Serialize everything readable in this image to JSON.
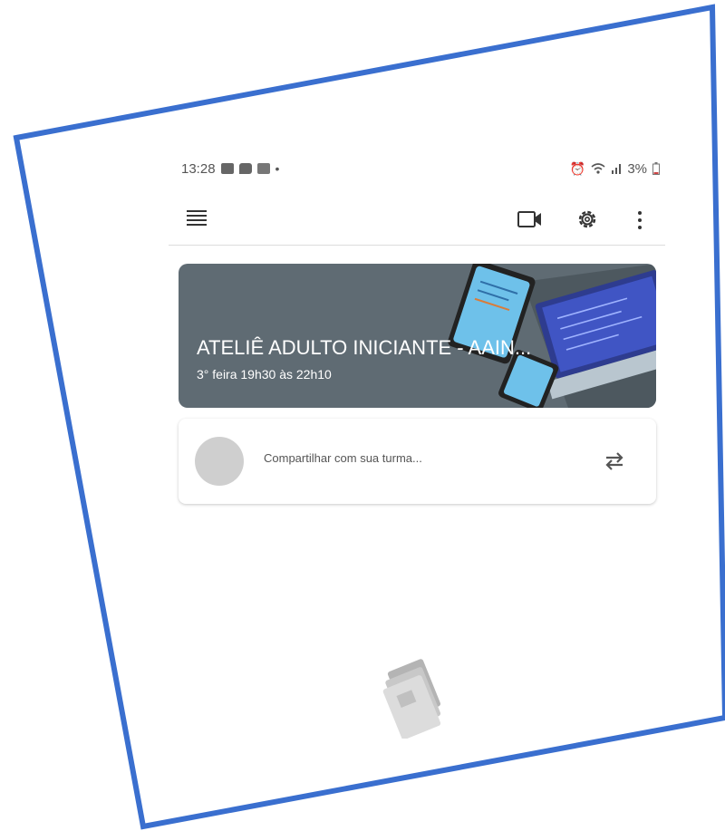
{
  "status_bar": {
    "time": "13:28",
    "battery": "3%",
    "left_icons": [
      "image-icon",
      "chat-icon",
      "calendar-icon"
    ],
    "right_icons": [
      "alarm-icon",
      "wifi-icon",
      "signal-icon",
      "battery-icon"
    ]
  },
  "app_bar": {
    "icons": [
      "menu-icon",
      "video-icon",
      "gear-icon",
      "more-vert-icon"
    ]
  },
  "class_banner": {
    "title": "ATELIÊ ADULTO INICIANTE - AAIN...",
    "subtitle": "3° feira 19h30 às 22h10",
    "background_color": "#5f6b73"
  },
  "share_card": {
    "placeholder": "Compartilhar com sua turma..."
  },
  "frame": {
    "border_color": "#3a6fcf"
  }
}
